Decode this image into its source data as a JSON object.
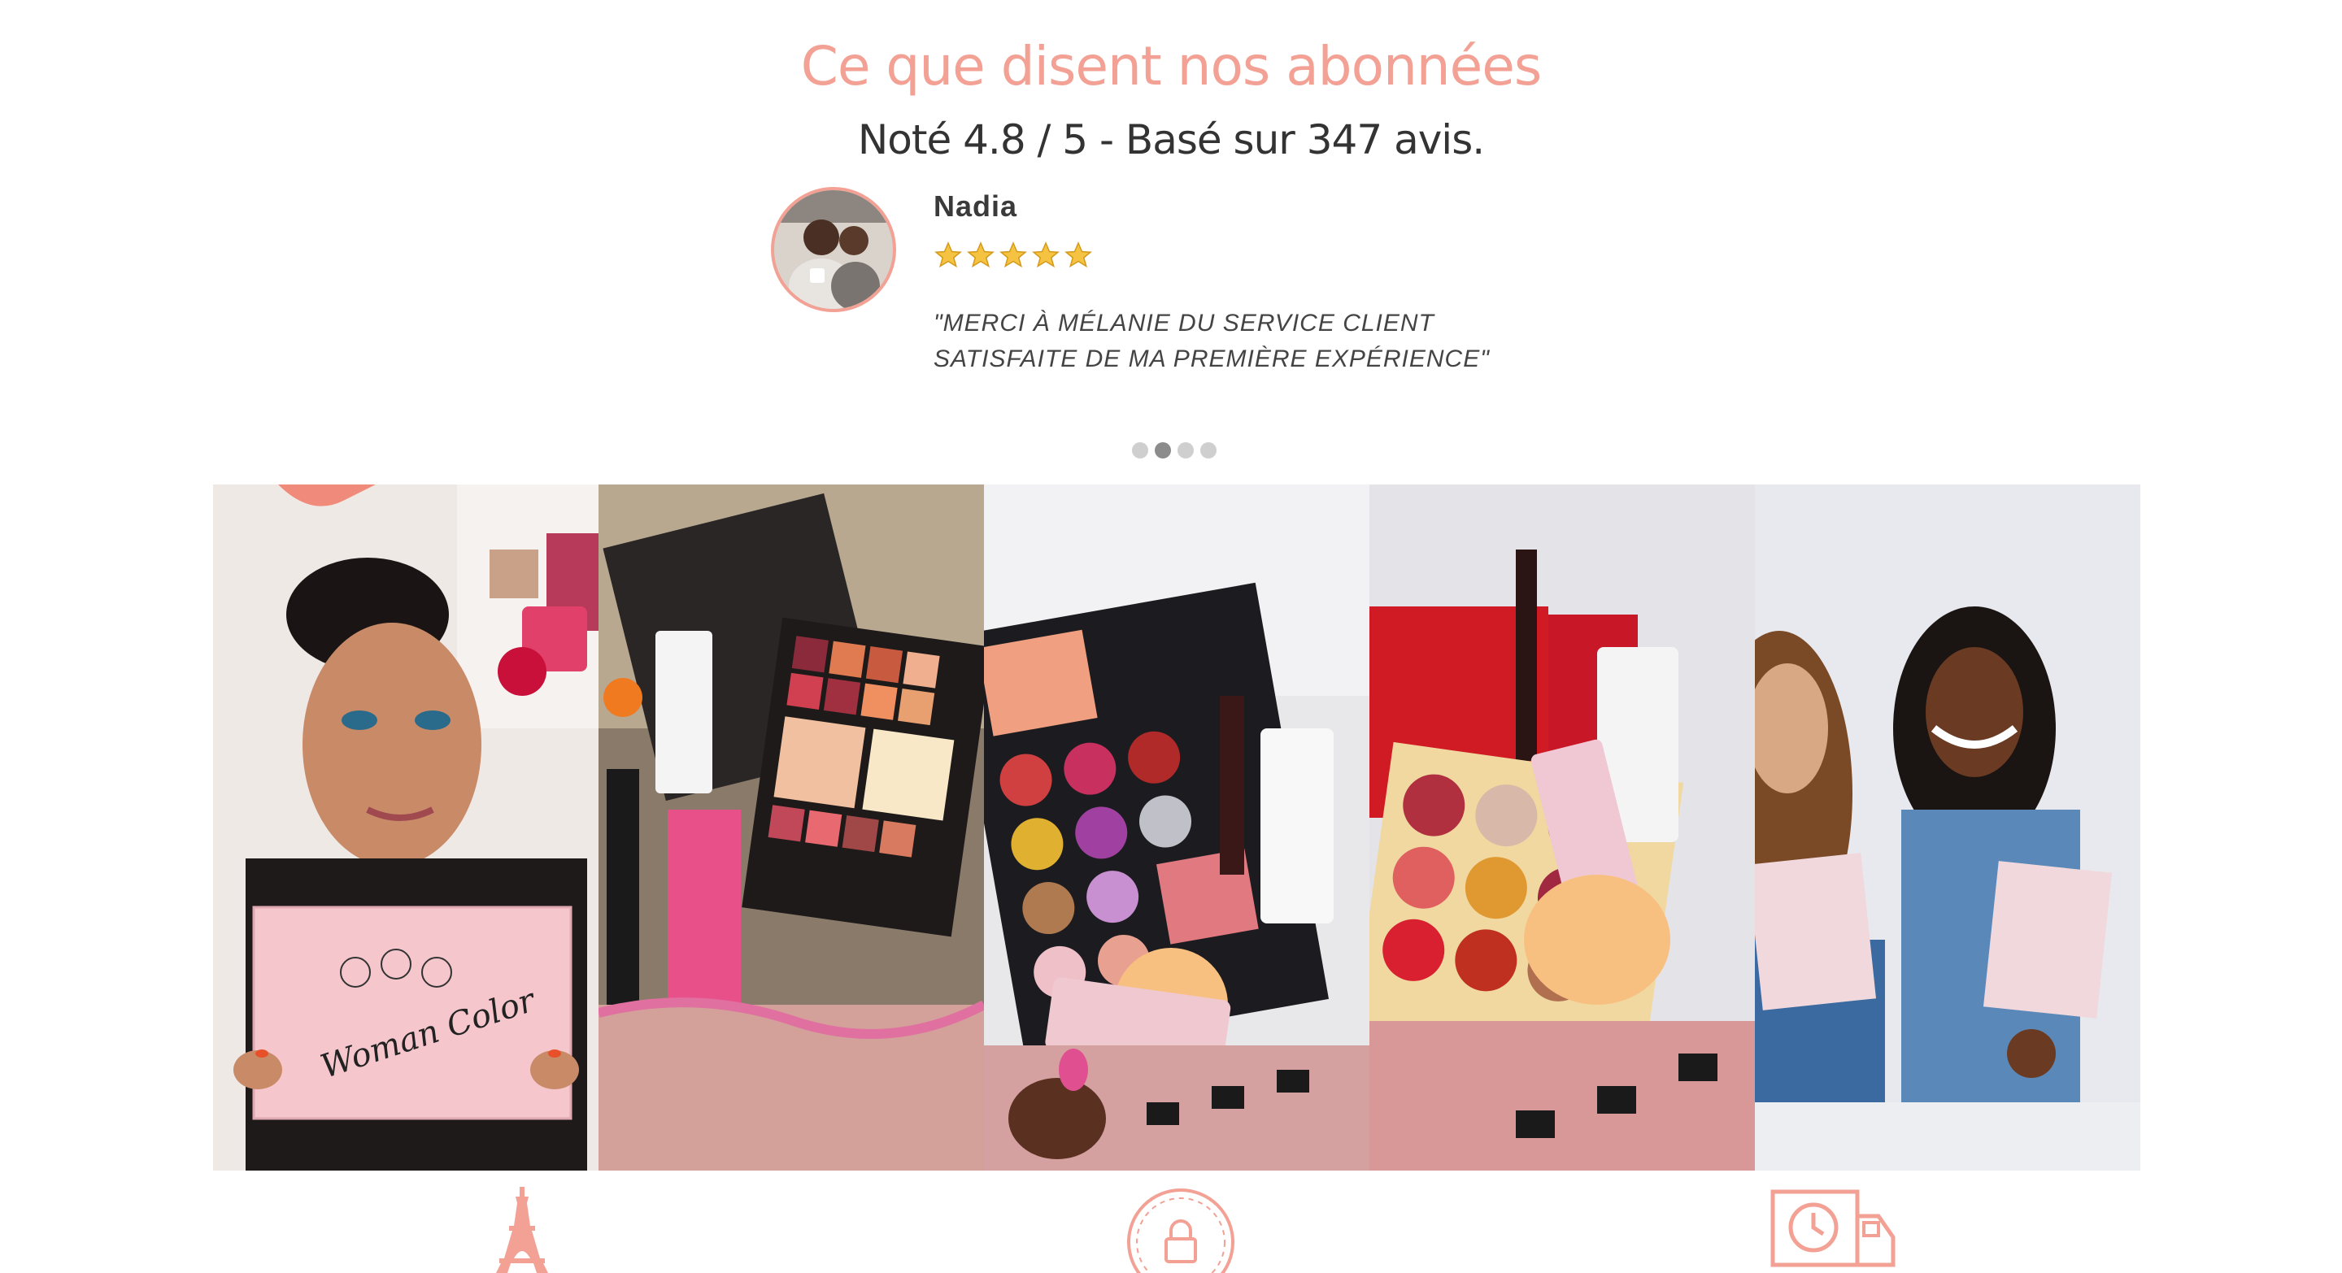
{
  "testimonials": {
    "title": "Ce que disent nos abonnées",
    "rating_line": "Noté 4.8 / 5 - Basé sur 347 avis.",
    "rating_value": 4.8,
    "rating_max": 5,
    "review_count": 347,
    "current_review": {
      "name": "Nadia",
      "stars": 5,
      "text": "\"MERCI À MÉLANIE DU SERVICE CLIENT SATISFAITE DE MA PREMIÈRE EXPÉRIENCE\"",
      "avatar_icon": "reviewer-avatar"
    },
    "slider": {
      "slides": 4,
      "active_index": 1
    }
  },
  "gallery": {
    "items": [
      {
        "label": "woman-holding-woman-color-box",
        "box_text": "Woman Color"
      },
      {
        "label": "makeup-palette-box"
      },
      {
        "label": "eyeshadow-palette-box"
      },
      {
        "label": "red-palette-box"
      },
      {
        "label": "two-women-opening-box"
      }
    ]
  },
  "features": {
    "icons": [
      "eiffel-tower-icon",
      "secure-lock-icon",
      "delivery-truck-icon"
    ]
  },
  "colors": {
    "accent": "#f2a194",
    "heading": "#333333",
    "dot_inactive": "#cfcfcf",
    "dot_active": "#8c8c8c",
    "star": "#f5c242"
  }
}
